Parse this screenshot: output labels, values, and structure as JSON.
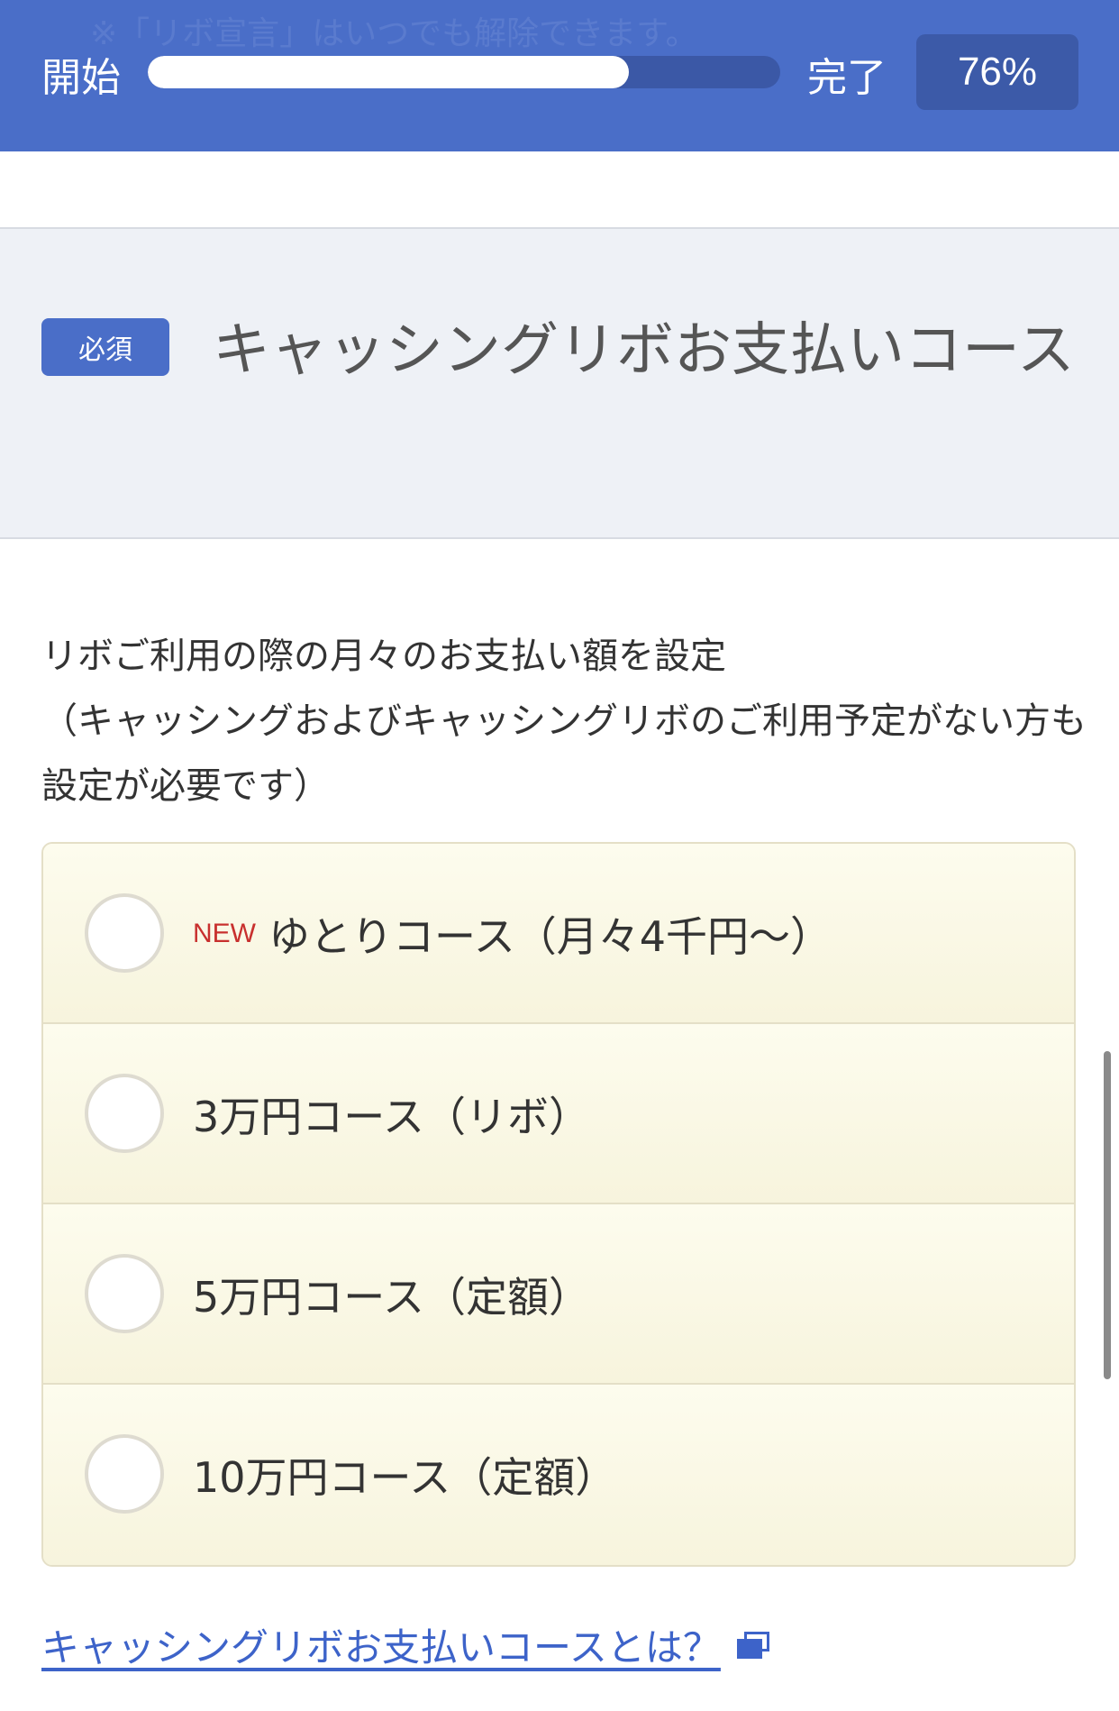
{
  "progress": {
    "behind_note": "※「リボ宣言」はいつでも解除できます。",
    "start_label": "開始",
    "end_label": "完了",
    "percent_label": "76%",
    "fill_fraction": 0.76
  },
  "section": {
    "required_badge": "必須",
    "title": "キャッシングリボお支払いコース"
  },
  "description": "リボご利用の際の月々のお支払い額を設定\n（キャッシングおよびキャッシングリボのご利用予定がない方も設定が必要です）",
  "options": [
    {
      "tag": "NEW",
      "label": "ゆとりコース（月々4千円〜）"
    },
    {
      "tag": "",
      "label": "3万円コース（リボ）"
    },
    {
      "tag": "",
      "label": "5万円コース（定額）"
    },
    {
      "tag": "",
      "label": "10万円コース（定額）"
    }
  ],
  "link": {
    "label": "キャッシングリボお支払いコースとは？",
    "icon": "external-window-icon"
  },
  "colors": {
    "header_blue": "#4a6ec8",
    "badge_blue": "#3c5aa8",
    "option_bg": "#fbf9e6",
    "new_red": "#c8302e",
    "link_blue": "#3d63c9"
  }
}
